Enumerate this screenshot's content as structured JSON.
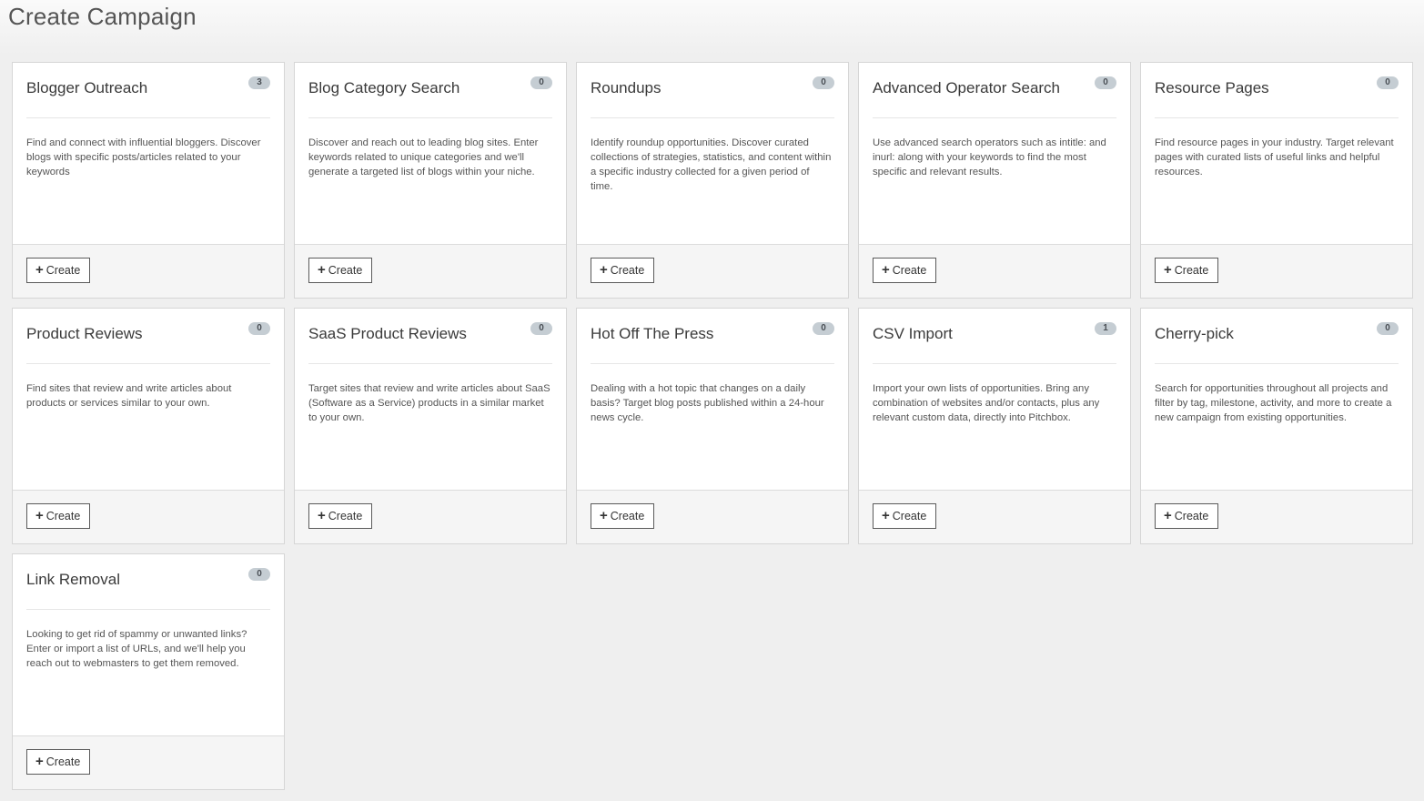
{
  "page": {
    "title": "Create Campaign"
  },
  "cards": [
    {
      "title": "Blogger Outreach",
      "count": "3",
      "description": "Find and connect with influential bloggers. Discover blogs with specific posts/articles related to your keywords",
      "button_label": "Create"
    },
    {
      "title": "Blog Category Search",
      "count": "0",
      "description": "Discover and reach out to leading blog sites. Enter keywords related to unique categories and we'll generate a targeted list of blogs within your niche.",
      "button_label": "Create"
    },
    {
      "title": "Roundups",
      "count": "0",
      "description": "Identify roundup opportunities. Discover curated collections of strategies, statistics, and content within a specific industry collected for a given period of time.",
      "button_label": "Create"
    },
    {
      "title": "Advanced Operator Search",
      "count": "0",
      "description": "Use advanced search operators such as intitle: and inurl: along with your keywords to find the most specific and relevant results.",
      "button_label": "Create"
    },
    {
      "title": "Resource Pages",
      "count": "0",
      "description": "Find resource pages in your industry. Target relevant pages with curated lists of useful links and helpful resources.",
      "button_label": "Create"
    },
    {
      "title": "Product Reviews",
      "count": "0",
      "description": "Find sites that review and write articles about products or services similar to your own.",
      "button_label": "Create"
    },
    {
      "title": "SaaS Product Reviews",
      "count": "0",
      "description": "Target sites that review and write articles about SaaS (Software as a Service) products in a similar market to your own.",
      "button_label": "Create"
    },
    {
      "title": "Hot Off The Press",
      "count": "0",
      "description": "Dealing with a hot topic that changes on a daily basis? Target blog posts published within a 24-hour news cycle.",
      "button_label": "Create"
    },
    {
      "title": "CSV Import",
      "count": "1",
      "description": "Import your own lists of opportunities. Bring any combination of websites and/or contacts, plus any relevant custom data, directly into Pitchbox.",
      "button_label": "Create"
    },
    {
      "title": "Cherry-pick",
      "count": "0",
      "description": "Search for opportunities throughout all projects and filter by tag, milestone, activity, and more to create a new campaign from existing opportunities.",
      "button_label": "Create"
    },
    {
      "title": "Link Removal",
      "count": "0",
      "description": "Looking to get rid of spammy or unwanted links? Enter or import a list of URLs, and we'll help you reach out to webmasters to get them removed.",
      "button_label": "Create"
    }
  ],
  "icons": {
    "plus": "plus-icon"
  }
}
